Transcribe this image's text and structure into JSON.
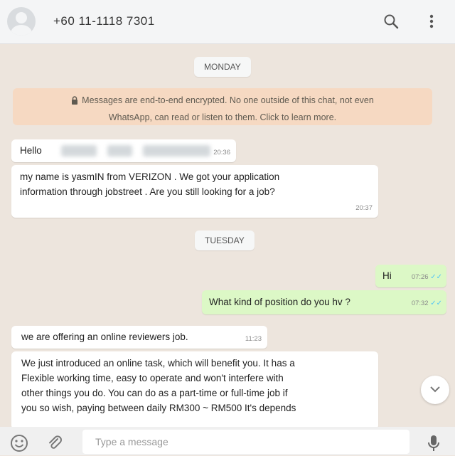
{
  "header": {
    "phone": "+60 11-1118 7301"
  },
  "days": {
    "monday": "MONDAY",
    "tuesday": "TUESDAY"
  },
  "encryption_notice_line1": "Messages are end-to-end encrypted. No one outside of this chat, not even",
  "encryption_notice_line2": "WhatsApp, can read or listen to them. Click to learn more.",
  "messages": [
    {
      "text": "Hello",
      "time": "20:36"
    },
    {
      "line1": "my name is yasmIN from VERIZON . We got your application",
      "line2": "information through jobstreet . Are you still looking for a job?",
      "time": "20:37"
    },
    {
      "text": "Hi",
      "time": "07:26"
    },
    {
      "text": "What kind of position do you hv ?",
      "time": "07:32"
    },
    {
      "text": "we are offering an online reviewers job.",
      "time": "11:23"
    },
    {
      "line1": "We just introduced an online task, which will benefit you. It has a",
      "line2": "Flexible working time, easy to operate and won't interfere with",
      "line3": "other things you do. You can do as a part-time or full-time job if",
      "line4": "you so wish, paying between daily  RM300 ~ RM500 It's depends"
    }
  ],
  "composer": {
    "placeholder": "Type a message"
  },
  "colors": {
    "incoming": "#ffffff",
    "outgoing": "#dcf8c6",
    "notice": "#f6d9c2",
    "background": "#ede5dd"
  },
  "icons": [
    "search-icon",
    "menu-icon",
    "lock-icon",
    "emoji-icon",
    "attach-icon",
    "mic-icon",
    "chevron-down-icon",
    "double-check-icon"
  ]
}
